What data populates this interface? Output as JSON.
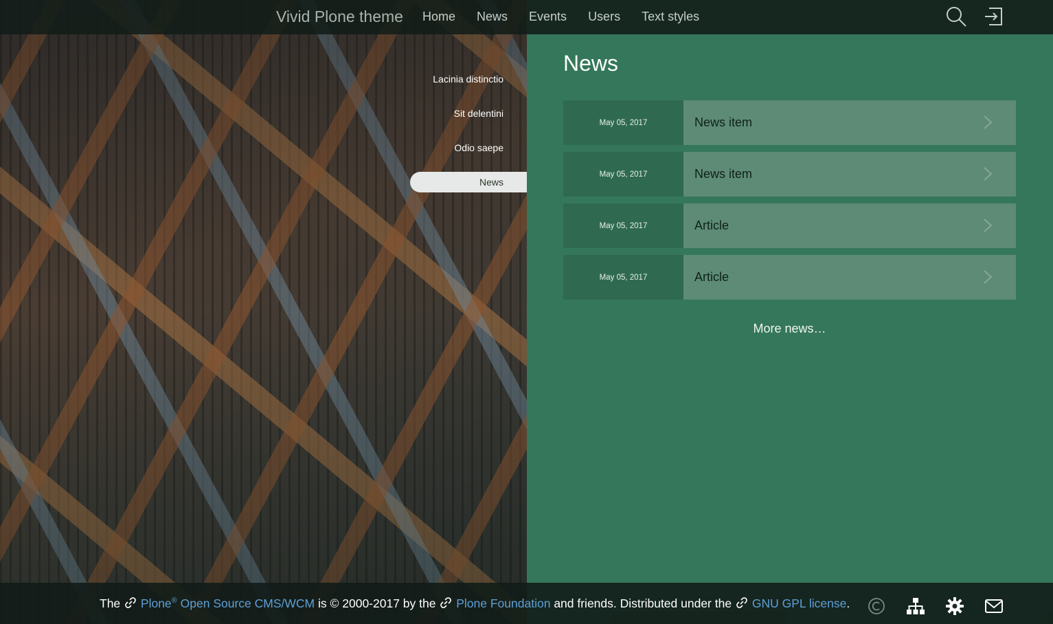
{
  "header": {
    "brand": "Vivid Plone theme",
    "nav": [
      "Home",
      "News",
      "Events",
      "Users",
      "Text styles"
    ],
    "icons": [
      "search-icon",
      "login-icon"
    ]
  },
  "sidenav": {
    "items": [
      {
        "label": "Lacinia distinctio",
        "active": false
      },
      {
        "label": "Sit delentini",
        "active": false
      },
      {
        "label": "Odio saepe",
        "active": false
      },
      {
        "label": "News",
        "active": true
      }
    ]
  },
  "news": {
    "title": "News",
    "items": [
      {
        "date": "May 05, 2017",
        "title": "News item"
      },
      {
        "date": "May 05, 2017",
        "title": "News item"
      },
      {
        "date": "May 05, 2017",
        "title": "Article"
      },
      {
        "date": "May 05, 2017",
        "title": "Article"
      }
    ],
    "more": "More news…"
  },
  "footer": {
    "t1": "The",
    "plone": "Plone",
    "reg": "®",
    "cms": "Open Source CMS/WCM",
    "t2": "is © 2000-2017 by the",
    "foundation": "Plone Foundation",
    "t3": "and friends. Distributed under the",
    "license": "GNU GPL license",
    "t4": ".",
    "icons": [
      "copyright-icon",
      "sitemap-icon",
      "settings-gear-icon",
      "mail-icon"
    ]
  },
  "colors": {
    "accent_green": "#35775a",
    "row_date": "#2f6a50",
    "row_link": "#5d8b76",
    "link_blue": "#5ea0d6"
  }
}
